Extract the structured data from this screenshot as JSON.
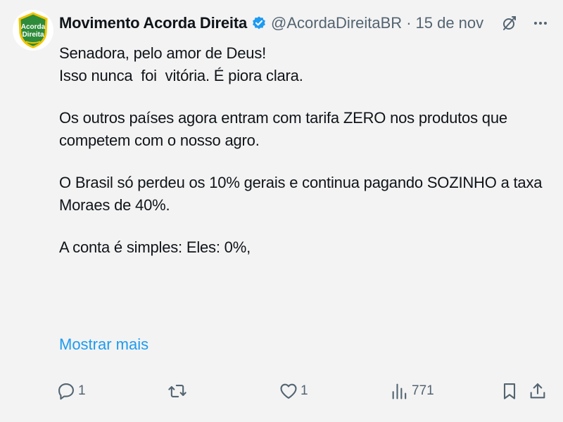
{
  "author": {
    "display_name": "Movimento Acorda Direita",
    "handle": "@AcordaDireitaBR",
    "separator": "·",
    "date": "15 de nov",
    "avatar_text_line1": "Acorda",
    "avatar_text_line2": "Direita"
  },
  "tweet": {
    "lines": [
      "Senadora, pelo amor de Deus!",
      "Isso nunca  foi  vitória. É piora clara.",
      "Os outros países agora entram com tarifa ZERO nos produtos que",
      "competem com o nosso agro.",
      "O Brasil só perdeu os 10% gerais e continua pagando SOZINHO a taxa",
      "Moraes de 40%.",
      "A conta é simples: Eles: 0%,"
    ],
    "show_more_label": "Mostrar mais"
  },
  "actions": {
    "reply_count": "1",
    "retweet_count": "",
    "like_count": "1",
    "views_count": "771"
  },
  "icons": {
    "verified": "verified-badge-icon",
    "grok": "grok-icon",
    "more": "more-icon",
    "reply": "reply-icon",
    "retweet": "retweet-icon",
    "like": "like-icon",
    "views": "views-icon",
    "bookmark": "bookmark-icon",
    "share": "share-icon"
  },
  "colors": {
    "background": "#f3f3f3",
    "text": "#0f1419",
    "secondary": "#536471",
    "link": "#1d9bf0",
    "verified": "#1d9bf0",
    "avatar_green": "#2e8b3a",
    "avatar_yellow": "#f2c500"
  }
}
